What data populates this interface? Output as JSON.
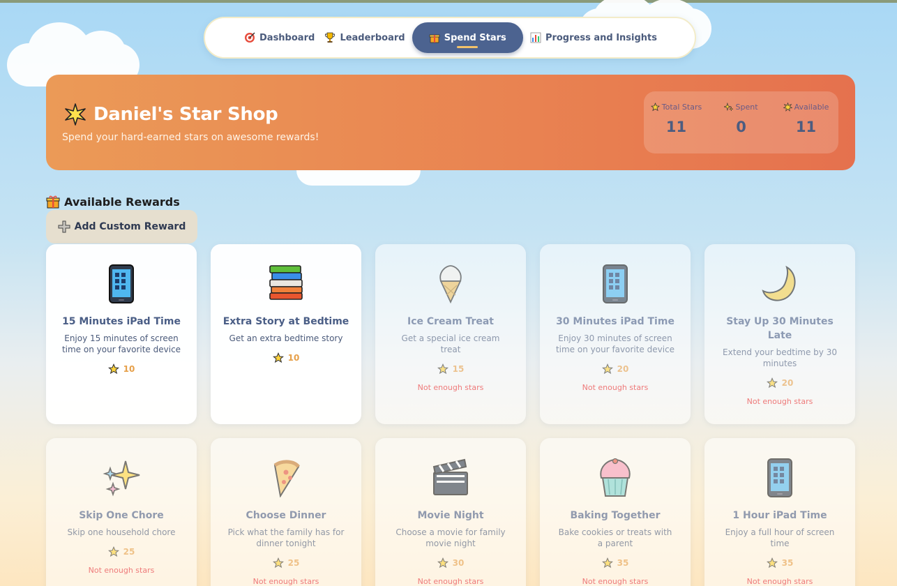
{
  "nav": {
    "items": [
      {
        "label": "Dashboard",
        "icon": "target-icon"
      },
      {
        "label": "Leaderboard",
        "icon": "trophy-icon"
      },
      {
        "label": "Spend Stars",
        "icon": "gift-icon",
        "active": true
      },
      {
        "label": "Progress and Insights",
        "icon": "bar-chart-icon"
      }
    ]
  },
  "banner": {
    "title": "Daniel's Star Shop",
    "subtitle": "Spend your hard-earned stars on awesome rewards!",
    "stats": [
      {
        "label": "Total Stars",
        "value": "11",
        "icon": "star-icon"
      },
      {
        "label": "Spent",
        "value": "0",
        "icon": "sparkle-icon"
      },
      {
        "label": "Available",
        "value": "11",
        "icon": "burst-icon"
      }
    ]
  },
  "section": {
    "title": "Available Rewards",
    "add_button": "Add Custom Reward"
  },
  "rewards": [
    {
      "title": "15 Minutes iPad Time",
      "desc": "Enjoy 15 minutes of screen time on your favorite device",
      "cost": "10",
      "icon": "tablet-icon",
      "affordable": true,
      "warning": ""
    },
    {
      "title": "Extra Story at Bedtime",
      "desc": "Get an extra bedtime story",
      "cost": "10",
      "icon": "books-icon",
      "affordable": true,
      "warning": ""
    },
    {
      "title": "Ice Cream Treat",
      "desc": "Get a special ice cream treat",
      "cost": "15",
      "icon": "ice-cream-icon",
      "affordable": false,
      "warning": "Not enough stars"
    },
    {
      "title": "30 Minutes iPad Time",
      "desc": "Enjoy 30 minutes of screen time on your favorite device",
      "cost": "20",
      "icon": "tablet-icon",
      "affordable": false,
      "warning": "Not enough stars"
    },
    {
      "title": "Stay Up 30 Minutes Late",
      "desc": "Extend your bedtime by 30 minutes",
      "cost": "20",
      "icon": "moon-icon",
      "affordable": false,
      "warning": "Not enough stars"
    },
    {
      "title": "Skip One Chore",
      "desc": "Skip one household chore",
      "cost": "25",
      "icon": "sparkles-icon",
      "affordable": false,
      "warning": "Not enough stars"
    },
    {
      "title": "Choose Dinner",
      "desc": "Pick what the family has for dinner tonight",
      "cost": "25",
      "icon": "pizza-icon",
      "affordable": false,
      "warning": "Not enough stars"
    },
    {
      "title": "Movie Night",
      "desc": "Choose a movie for family movie night",
      "cost": "30",
      "icon": "clapperboard-icon",
      "affordable": false,
      "warning": "Not enough stars"
    },
    {
      "title": "Baking Together",
      "desc": "Bake cookies or treats with a parent",
      "cost": "35",
      "icon": "cupcake-icon",
      "affordable": false,
      "warning": "Not enough stars"
    },
    {
      "title": "1 Hour iPad Time",
      "desc": "Enjoy a full hour of screen time",
      "cost": "35",
      "icon": "tablet-icon",
      "affordable": false,
      "warning": "Not enough stars"
    }
  ]
}
